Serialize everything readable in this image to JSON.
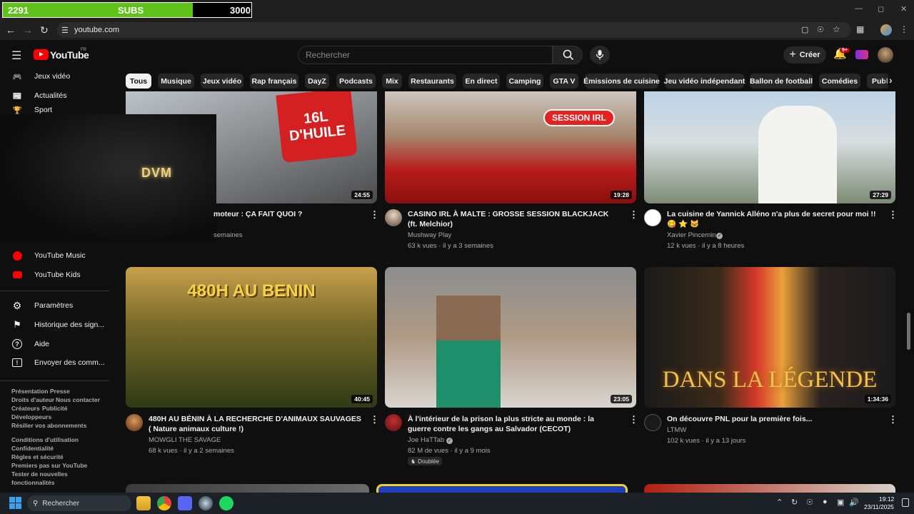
{
  "overlay": {
    "current": "2291",
    "label": "SUBS",
    "goal": "3000",
    "progress": 0.7637
  },
  "browser": {
    "url": "youtube.com"
  },
  "youtube": {
    "logo": "YouTube",
    "region": "FR",
    "search_placeholder": "Rechercher",
    "create_label": "Créer",
    "notif_badge": "9+"
  },
  "chips": [
    "Tous",
    "Musique",
    "Jeux vidéo",
    "Rap français",
    "DayZ",
    "Podcasts",
    "Mix",
    "Restaurants",
    "En direct",
    "Camping",
    "GTA V",
    "Émissions de cuisine",
    "Jeu vidéo indépendant",
    "Ballon de football",
    "Comédies",
    "Publi"
  ],
  "sidebar": {
    "top_items": [
      {
        "label": "Jeux vidéo",
        "icon": "game-icon"
      },
      {
        "label": "Actualités",
        "icon": "news-icon"
      },
      {
        "label": "Sport",
        "icon": "trophy-icon"
      }
    ],
    "more_items": [
      {
        "label": "YouTube Music",
        "icon": "youtube-music-icon"
      },
      {
        "label": "YouTube Kids",
        "icon": "youtube-kids-icon"
      }
    ],
    "settings_items": [
      {
        "label": "Paramètres",
        "icon": "gear-icon"
      },
      {
        "label": "Historique des sign...",
        "icon": "flag-icon"
      },
      {
        "label": "Aide",
        "icon": "help-icon"
      },
      {
        "label": "Envoyer des comm...",
        "icon": "feedback-icon"
      }
    ],
    "footer1": [
      "Présentation",
      "Presse",
      "Droits d'auteur",
      "Nous contacter",
      "Créateurs",
      "Publicité",
      "Développeurs",
      "Résilier vos abonnements"
    ],
    "footer2": [
      "Conditions d'utilisation",
      "Confidentialité",
      "Règles et sécurité",
      "Premiers pas sur YouTube",
      "Tester de nouvelles",
      "fonctionnalités"
    ]
  },
  "webcam": {
    "logo": "DVM"
  },
  "videos": [
    {
      "title": "moteur : ÇA FAIT QUOI ?",
      "channel": "",
      "meta": "semaines",
      "duration": "24:55",
      "thumb_text": "16L D'HUILE",
      "verified": false,
      "dubbed": ""
    },
    {
      "title": "CASINO IRL À MALTE : GROSSE SESSION BLACKJACK (ft. Melchior)",
      "channel": "Mushway Play",
      "meta": "63 k vues · il y a 3 semaines",
      "duration": "19:28",
      "thumb_text": "SESSION IRL",
      "verified": false,
      "dubbed": ""
    },
    {
      "title": "La cuisine de Yannick Alléno n'a plus de secret pour moi !! 😋 ⭐ 🐱",
      "channel": "Xavier Pincemin",
      "meta": "12 k vues · il y a 8 heures",
      "duration": "27:29",
      "thumb_text": "",
      "verified": true,
      "dubbed": ""
    },
    {
      "title": "480H AU BÉNIN À LA RECHERCHE D'ANIMAUX SAUVAGES ( Nature animaux culture !)",
      "channel": "MOWGLI THE SAVAGE",
      "meta": "68 k vues · il y a 2 semaines",
      "duration": "40:45",
      "thumb_text": "480H AU BENIN",
      "verified": false,
      "dubbed": ""
    },
    {
      "title": "À l'intérieur de la prison la plus stricte au monde : la guerre contre les gangs au Salvador (CECOT)",
      "channel": "Joe HaTTab",
      "meta": "82 M de vues · il y a 9 mois",
      "duration": "23:05",
      "thumb_text": "",
      "verified": true,
      "dubbed": "Doublée"
    },
    {
      "title": "On découvre PNL pour la première fois...",
      "channel": "LTMW",
      "meta": "102 k vues · il y a 13 jours",
      "duration": "1:34:36",
      "thumb_text": "DANS LA LÉGENDE",
      "verified": false,
      "dubbed": ""
    }
  ],
  "taskbar": {
    "search": "Rechercher",
    "time": "19:12",
    "date": "23/11/2025"
  },
  "colors": {
    "bg": "#0f0f0f",
    "accent": "#ff0000",
    "progress": "#5ec21a"
  }
}
